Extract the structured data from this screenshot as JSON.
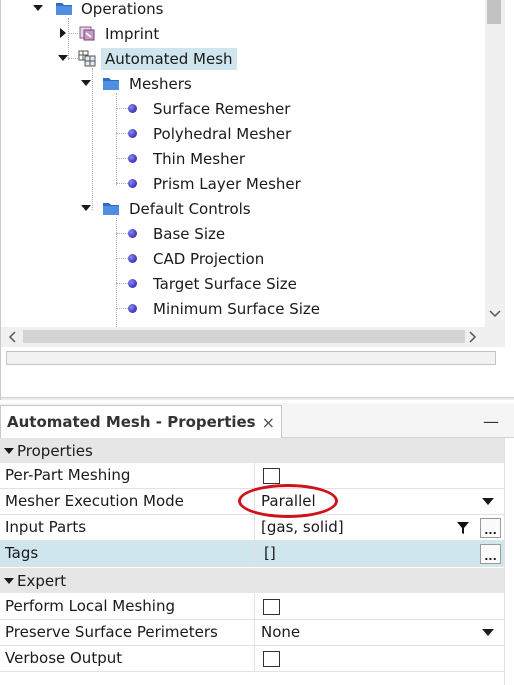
{
  "tree": {
    "operations": "Operations",
    "imprint": "Imprint",
    "automated_mesh": "Automated Mesh",
    "meshers": "Meshers",
    "surface_remesher": "Surface Remesher",
    "polyhedral_mesher": "Polyhedral Mesher",
    "thin_mesher": "Thin Mesher",
    "prism_layer_mesher": "Prism Layer Mesher",
    "default_controls": "Default Controls",
    "base_size": "Base Size",
    "cad_projection": "CAD Projection",
    "target_surface_size": "Target Surface Size",
    "minimum_surface_size": "Minimum Surface Size"
  },
  "props": {
    "tab_title": "Automated Mesh - Properties",
    "tab_close": "×",
    "minimize": "—",
    "section_properties": "Properties",
    "section_expert": "Expert",
    "per_part_meshing": "Per-Part Meshing",
    "mesher_execution_mode": "Mesher Execution Mode",
    "mesher_execution_mode_value": "Parallel",
    "input_parts": "Input Parts",
    "input_parts_value": "[gas, solid]",
    "tags": "Tags",
    "tags_value": "[]",
    "perform_local_meshing": "Perform Local Meshing",
    "preserve_surface_perimeters": "Preserve Surface Perimeters",
    "preserve_surface_perimeters_value": "None",
    "verbose_output": "Verbose Output",
    "ellipsis": "..."
  },
  "colors": {
    "selection": "#cfe6ee",
    "annotation_circle": "#d0121b",
    "bullet": "#3a32b8"
  },
  "icons": {
    "folder": "folder-icon",
    "imprint": "imprint-icon",
    "mesh": "automated-mesh-icon",
    "bullet": "bullet-icon",
    "filter": "filter-icon"
  }
}
